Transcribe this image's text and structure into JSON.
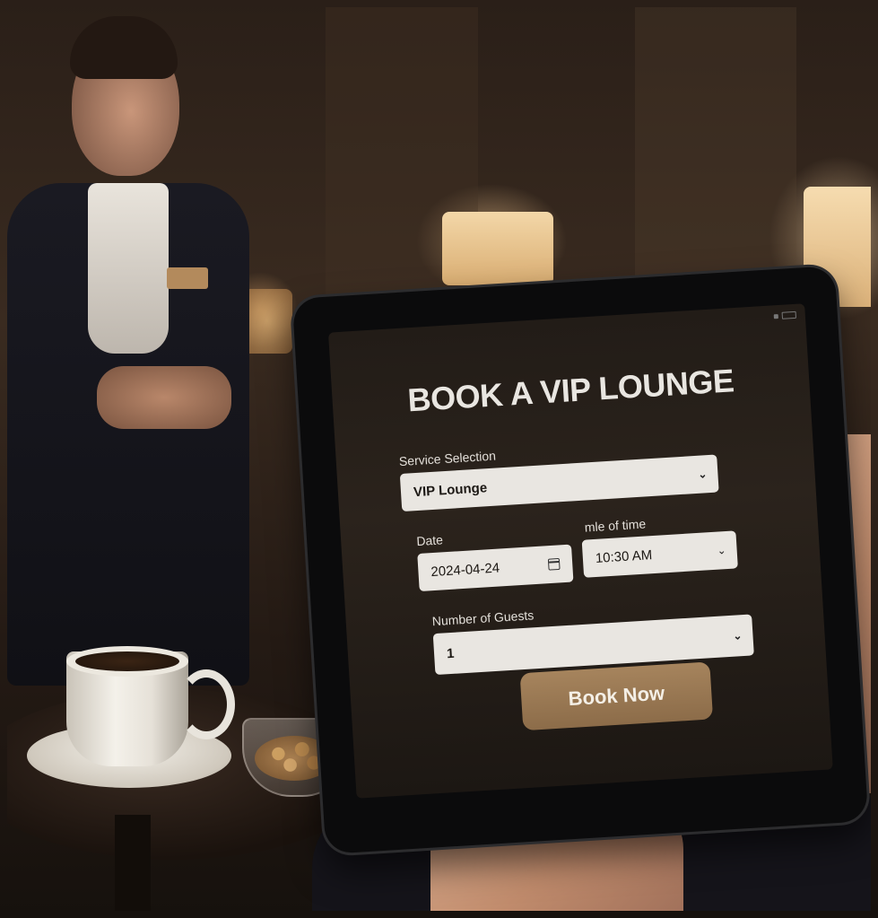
{
  "booking_form": {
    "title": "BOOK A VIP LOUNGE",
    "service": {
      "label": "Service Selection",
      "value": "VIP Lounge"
    },
    "date": {
      "label": "Date",
      "value": "2024-04-24"
    },
    "time": {
      "label": "mle of time",
      "value": "10:30 AM"
    },
    "guests": {
      "label": "Number of Guests",
      "value": "1"
    },
    "submit_label": "Book Now"
  },
  "icons": {
    "dropdown": "chevron-down-icon",
    "date": "calendar-icon"
  },
  "colors": {
    "screen_bg": "#221c17",
    "field_bg": "#e9e6e1",
    "button_bg": "#9a7852",
    "title_text": "#e9e6e1"
  }
}
